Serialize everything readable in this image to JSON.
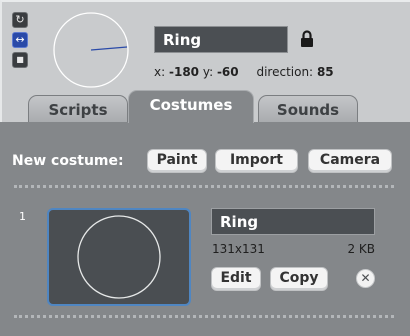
{
  "sprite": {
    "name": "Ring",
    "x_label": "x:",
    "x_value": "-180",
    "y_label": "y:",
    "y_value": "-60",
    "direction_label": "direction:",
    "direction_value": "85"
  },
  "rotation_style_buttons": [
    {
      "icon": "rotate-all-around-icon",
      "glyph": "↻"
    },
    {
      "icon": "left-right-flip-icon",
      "glyph": "↔"
    },
    {
      "icon": "dont-rotate-icon",
      "glyph": "■"
    }
  ],
  "tabs": [
    {
      "label": "Scripts"
    },
    {
      "label": "Costumes"
    },
    {
      "label": "Sounds"
    }
  ],
  "new_costume": {
    "label": "New costume:",
    "paint_label": "Paint",
    "import_label": "Import",
    "camera_label": "Camera"
  },
  "costumes": [
    {
      "number": "1",
      "name": "Ring",
      "dimensions": "131x131",
      "size": "2 KB",
      "edit_label": "Edit",
      "copy_label": "Copy",
      "delete_glyph": "✕"
    }
  ],
  "colors": {
    "panel_background": "#c9cbcd",
    "content_background": "#84878a",
    "active_tab": "#84878a",
    "field_background": "#4b4f53",
    "thumbnail_border": "#4f86c2"
  }
}
